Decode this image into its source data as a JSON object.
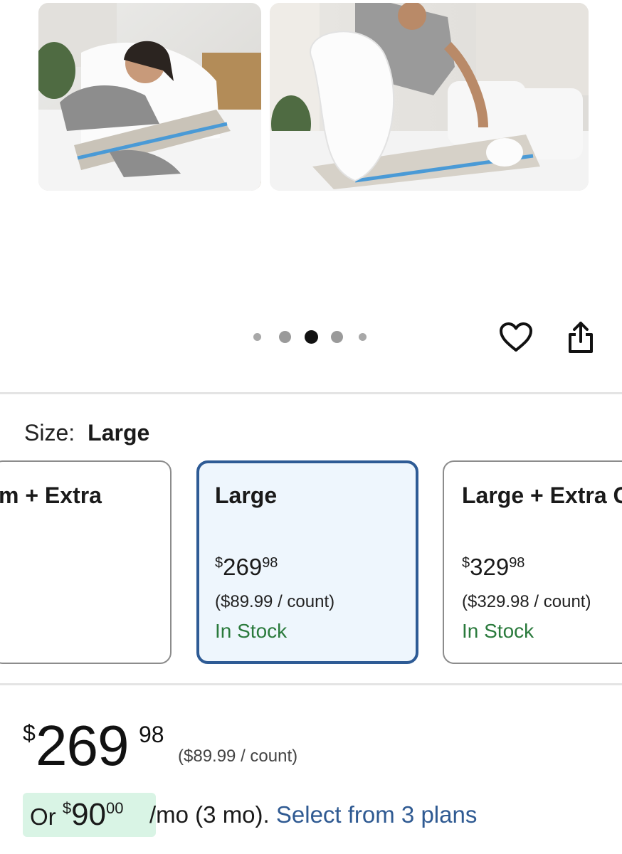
{
  "gallery": {
    "images": [
      {
        "alt": "woman-lying-on-wedge-pillow"
      },
      {
        "alt": "man-placing-pillow-on-bed"
      }
    ],
    "dots": 5,
    "active_dot": 3
  },
  "icons": {
    "favorite": "heart-outline-icon",
    "share": "share-icon"
  },
  "size": {
    "label": "Size:",
    "selected": "Large"
  },
  "options": [
    {
      "title": "m + Extra",
      "price_currency": "",
      "price_dollars": "",
      "price_cents": "",
      "unit": ")",
      "stock": "",
      "selected": false
    },
    {
      "title": "Large",
      "price_currency": "$",
      "price_dollars": "269",
      "price_cents": "98",
      "unit": "($89.99 / count)",
      "stock": "In Stock",
      "selected": true
    },
    {
      "title": "Large + Extra C",
      "price_currency": "$",
      "price_dollars": "329",
      "price_cents": "98",
      "unit": "($329.98 / count)",
      "stock": "In Stock",
      "selected": false
    }
  ],
  "price": {
    "currency": "$",
    "dollars": "269",
    "cents": "98",
    "unit": "($89.99 / count)"
  },
  "financing": {
    "prefix": "Or ",
    "currency": "$",
    "dollars": "90",
    "cents": "00",
    "term": "/mo (3 mo).",
    "link": "Select from 3 plans"
  },
  "colors": {
    "selected_border": "#2e5b95",
    "selected_bg": "#eef6fd",
    "in_stock": "#2a7a3c",
    "link": "#2f5a92",
    "affirm_badge": "#d9f4e5"
  }
}
